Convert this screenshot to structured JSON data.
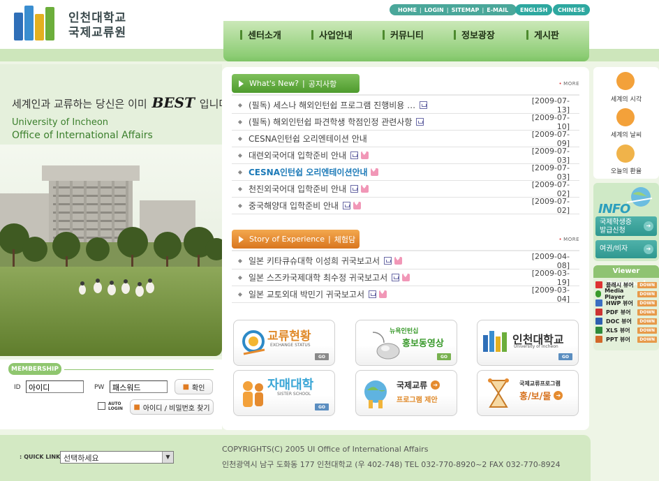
{
  "header": {
    "logo_line1": "인천대학교",
    "logo_line2": "국제교류원",
    "top_links": [
      "HOME",
      "LOGIN",
      "SITEMAP",
      "E-MAIL"
    ],
    "lang_english": "ENGLISH",
    "lang_chinese": "CHINESE",
    "nav": [
      "센터소개",
      "사업안내",
      "커뮤니티",
      "정보광장",
      "게시판"
    ]
  },
  "hero": {
    "slogan_pre": "세계인과 교류하는 당신은 이미",
    "slogan_best": "BEST",
    "slogan_post": "입니다",
    "en_line1": "University of Incheon",
    "en_line2": "Office of International Affairs"
  },
  "login": {
    "section_label": "MEMBERSHIP",
    "id_label": "ID",
    "pw_label": "PW",
    "id_value": "아이디",
    "pw_value": "패스워드",
    "login_button": "확인",
    "auto_login_line1": "AUTO",
    "auto_login_line2": "LOGIN",
    "find_button": "아이디 / 비밀번호 찾기"
  },
  "news": {
    "tab_en": "What's New?",
    "tab_ko": "공지사항",
    "more": "MORE",
    "items": [
      {
        "title": "(필독) 세스나 해외인턴쉽 프로그램 진행비용 …",
        "date": "[2009-07-13]"
      },
      {
        "title": "(필독) 해외인턴쉽 파견학생 학점인정 관련사항",
        "date": "[2009-07-10]"
      },
      {
        "title": "CESNA인턴쉽 오리엔테이션 안내",
        "date": "[2009-07-09]"
      },
      {
        "title": "대련외국어대 입학준비 안내",
        "date": "[2009-07-03]"
      },
      {
        "title": "CESNA인턴쉽 오리엔테이션안내",
        "date": "[2009-07-03]"
      },
      {
        "title": "천진외국어대 입학준비 안내",
        "date": "[2009-07-02]"
      },
      {
        "title": "중국해양대 입학준비 안내",
        "date": "[2009-07-02]"
      }
    ]
  },
  "story": {
    "tab_en": "Story of Experience",
    "tab_ko": "체험담",
    "more": "MORE",
    "items": [
      {
        "title": "일본 키타큐슈대학 이성희 귀국보고서",
        "date": "[2009-04-08]"
      },
      {
        "title": "일본 스즈카국제대학 최수정 귀국보고서",
        "date": "[2009-03-19]"
      },
      {
        "title": "일본 교토외대 박민기 귀국보고서",
        "date": "[2009-03-04]"
      }
    ]
  },
  "banners": {
    "exchange_title": "교류현황",
    "exchange_sub": "EXCHANGE STATUS",
    "newyork_title": "뉴욕인턴십",
    "newyork_sub": "홍보동영상",
    "univ_title": "인천대학교",
    "univ_sub": "University of Incheon",
    "sister_title": "자매대학",
    "sister_sub": "SISTER SCHOOL",
    "program_title": "국제교류",
    "program_sub": "프로그램 제안",
    "promo_title": "국제교류프로그램",
    "promo_sub": "홍/보/물",
    "go": "GO"
  },
  "right": {
    "world_time": "세계의 시각",
    "world_weather": "세계의 날씨",
    "exchange_rate": "오늘의 환율",
    "info_big": "INFO",
    "student_card_line1": "국제학생증",
    "student_card_line2": "발급신청",
    "passport": "여권/비자",
    "viewer_title": "Viewer Download",
    "viewers": [
      "플래시 뷰어",
      "Media Player",
      "HWP 뷰어",
      "PDF 뷰어",
      "DOC 뷰어",
      "XLS 뷰어",
      "PPT 뷰어"
    ],
    "down": "DOWN"
  },
  "footer": {
    "quick_link": "QUICK LINK",
    "select_value": "선택하세요",
    "copyright": "COPYRIGHTS(C) 2005 UI Office of International Affairs",
    "address": "인천광역시 남구 도화동 177 인천대학교 (우 402-748) TEL 032-770-8920~2 FAX 032-770-8924"
  },
  "colors": {
    "accent_green": "#8fc66f",
    "nav_green": "#8ecd76",
    "teal": "#2ea8a0",
    "news_tab": "#5fa83a",
    "story_tab": "#e58b2f",
    "highlight_blue": "#1c7ab8"
  }
}
